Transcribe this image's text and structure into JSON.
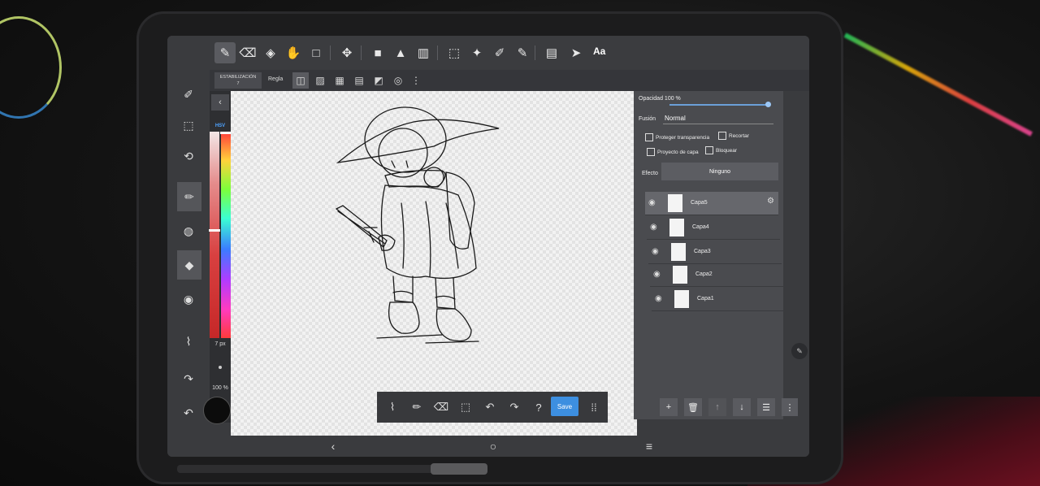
{
  "topbar": {
    "text_tool_label": "Aa"
  },
  "subbar": {
    "stabilization_label": "ESTABILIZACIÓN",
    "stabilization_value": "7",
    "ruler_label": "Regla"
  },
  "color_panel": {
    "mode_label": "HSV",
    "brush_size": "7 px",
    "brush_opacity": "100 %",
    "current_color": "#0c0c0c"
  },
  "layer_panel": {
    "opacity_label": "Opacidad",
    "opacity_value": "100 %",
    "opacity_fraction": 1.0,
    "blend_label": "Fusión",
    "blend_value": "Normal",
    "protect_transparency_label": "Proteger transparencia",
    "clip_label": "Recortar",
    "layer_project_label": "Proyecto de capa",
    "lock_label": "Bloquear",
    "effect_label": "Efecto",
    "effect_value": "Ninguno",
    "layers": [
      {
        "name": "Capa5",
        "active": true
      },
      {
        "name": "Capa4",
        "active": false
      },
      {
        "name": "Capa3",
        "active": false
      },
      {
        "name": "Capa2",
        "active": false
      },
      {
        "name": "Capa1",
        "active": false
      }
    ]
  },
  "bottom_tools": {
    "save_label": "Save"
  },
  "colors": {
    "accent_blue": "#3d8fe0",
    "panel_bg": "#3a3b3e"
  }
}
